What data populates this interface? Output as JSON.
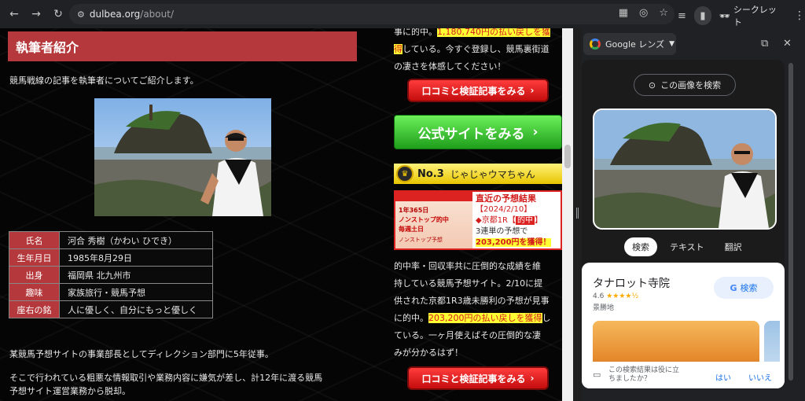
{
  "browser": {
    "back": "←",
    "forward": "→",
    "reload": "↻",
    "url_host": "dulbea.org",
    "url_path": "/about/",
    "incognito_label": "シークレット"
  },
  "page": {
    "section_heading": "執筆者紹介",
    "intro": "競馬戦線の記事を執筆者についてご紹介します。",
    "profile": [
      {
        "key": "氏名",
        "value": "河合 秀樹（かわい ひでき）"
      },
      {
        "key": "生年月日",
        "value": "1985年8月29日"
      },
      {
        "key": "出身",
        "value": "福岡県 北九州市"
      },
      {
        "key": "趣味",
        "value": "家族旅行・競馬予想"
      },
      {
        "key": "座右の銘",
        "value": "人に優しく、自分にもっと優しく"
      }
    ],
    "para1": "某競馬予想サイトの事業部長としてディレクション部門に5年従事。",
    "para2a": "そこで行われている粗悪な情報取引や業務内容に嫌気が差し、計12年に渡る競馬",
    "para2b": "予想サイト運営業務から脱却。"
  },
  "sidebar": {
    "top_line1_pre": "事に的中。",
    "top_line1_hl": "1,180,740円の払い戻しを獲",
    "top_line2_hl": "得",
    "top_line2_post": "している。今すぐ登録し、競馬裏街道",
    "top_line3": "の凄さを体感してください！",
    "review_button": "口コミと検証記事をみる",
    "official_button": "公式サイトをみる",
    "rank_label": "No.3",
    "rank_name": "じゃじゃウマちゃん",
    "thumb_line1": "1年365日",
    "thumb_line2": "毎週土日",
    "thumb_line3": "ノンストップ的中",
    "thumb_line4": "ノンストップ予想",
    "result_title": "直近の予想結果",
    "result_date": "【2024/2/10】",
    "result_race": "◆京都1R【",
    "result_race_tag": "的中",
    "result_race_end": "】",
    "result_payout": "3連単の予想で",
    "result_amount": "203,200円を獲得！",
    "desc1": "的中率・回収率共に圧倒的な成績を維",
    "desc2": "持している競馬予想サイト。2/10に提",
    "desc3": "供された京都1R3歳未勝利の予想が見事",
    "desc4_pre": "に的中。",
    "desc4_hl": "203,200円の払い戻しを獲得",
    "desc4_post": "し",
    "desc5": "ている。一ヶ月使えばその圧倒的な凄",
    "desc6": "みが分かるはず！",
    "review_button2": "口コミと検証記事をみる"
  },
  "lens": {
    "title": "Google レンズ",
    "search_image": "この画像を検索",
    "tabs": [
      "検索",
      "テキスト",
      "翻訳"
    ],
    "place_name": "タナロット寺院",
    "rating": "4.6",
    "stars": "★★★★½",
    "place_type": "景勝地",
    "search_button": "検索",
    "feedback_q": "この検索結果は役に立ちましたか？",
    "yes": "はい",
    "no": "いいえ"
  }
}
